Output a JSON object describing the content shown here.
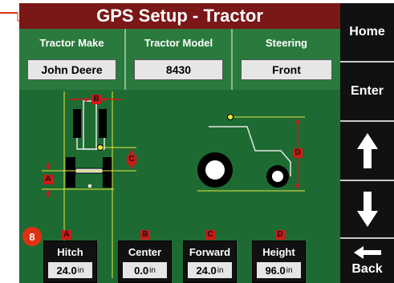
{
  "header": {
    "title": "GPS Setup - Tractor"
  },
  "nav": {
    "home": "Home",
    "enter": "Enter",
    "back": "Back"
  },
  "params": [
    {
      "label": "Tractor Make",
      "value": "John Deere"
    },
    {
      "label": "Tractor Model",
      "value": "8430"
    },
    {
      "label": "Steering",
      "value": "Front"
    }
  ],
  "diagram_letters": {
    "a": "A",
    "b": "B",
    "c": "C",
    "d": "D"
  },
  "fields": [
    {
      "letter": "A",
      "label": "Hitch",
      "value": "24.0",
      "unit": "in"
    },
    {
      "letter": "B",
      "label": "Center",
      "value": "0.0",
      "unit": "in"
    },
    {
      "letter": "C",
      "label": "Forward",
      "value": "24.0",
      "unit": "in"
    },
    {
      "letter": "D",
      "label": "Height",
      "value": "96.0",
      "unit": "in"
    }
  ],
  "callout": "8",
  "colors": {
    "header_bg": "#7a1717",
    "panel_green": "#2a7a3d",
    "diagram_green": "#1d6b32",
    "marker_red": "#d01818",
    "guide_yellow": "#e8e842",
    "callout_orange": "#e03012"
  }
}
